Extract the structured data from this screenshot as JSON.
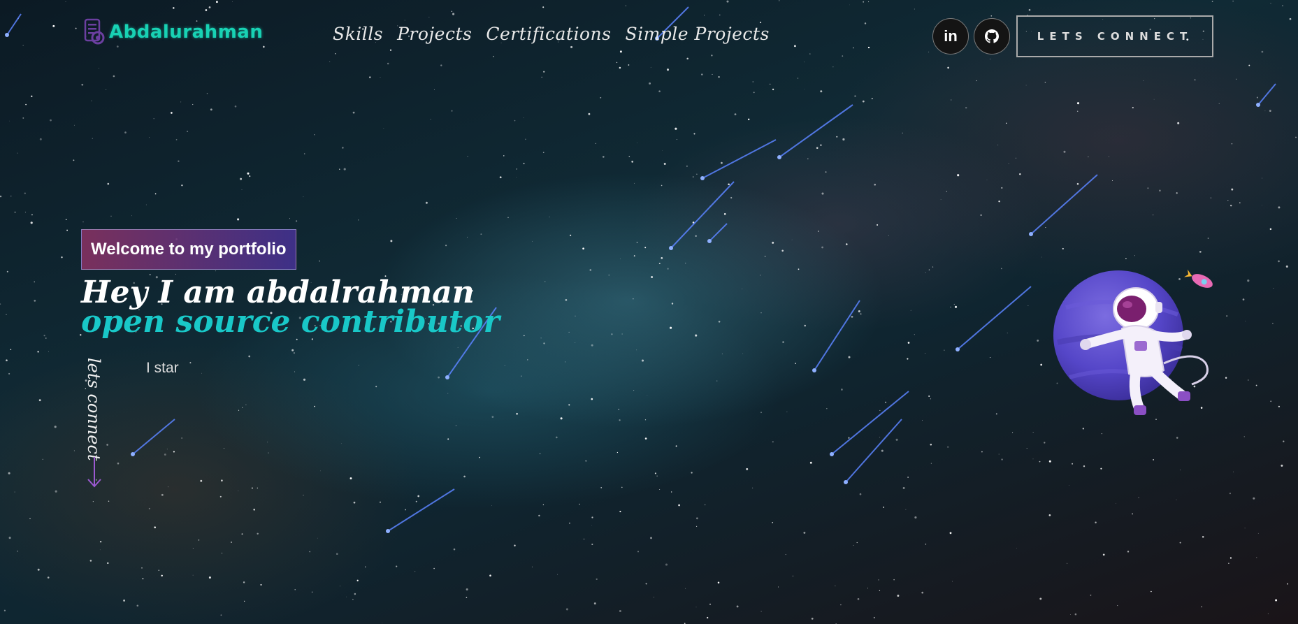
{
  "header": {
    "logo_text": "Abdalurahman",
    "nav": [
      {
        "label": "Skills"
      },
      {
        "label": "Projects"
      },
      {
        "label": "Certifications"
      },
      {
        "label": "Simple Projects"
      }
    ],
    "social": [
      {
        "icon": "linkedin-icon",
        "label": "in"
      },
      {
        "icon": "github-icon"
      }
    ],
    "connect_button": "LETS CONNECT"
  },
  "hero": {
    "tagline": "Welcome to my portfolio",
    "title_line1": "Hey I am abdalrahman",
    "title_line2": "open source contributor",
    "vertical_link": "lets connect",
    "typing_text": "I star"
  },
  "colors": {
    "accent": "#19c8c8",
    "logo": "#18d2b4",
    "tagline_start": "#8c3264",
    "tagline_end": "#463296",
    "arrow": "#9b59d0"
  }
}
